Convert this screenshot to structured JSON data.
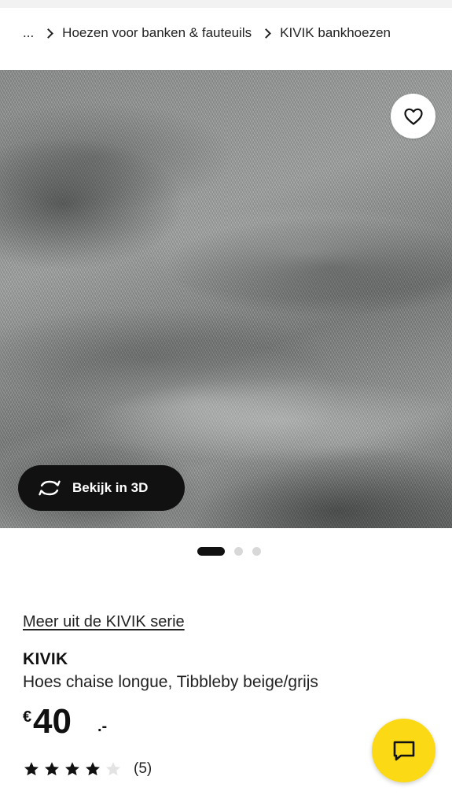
{
  "breadcrumb": {
    "ellipsis": "...",
    "items": [
      "Hoezen voor banken & fauteuils",
      "KIVIK bankhoezen"
    ]
  },
  "hero": {
    "favorite_icon": "heart-outline-icon",
    "view_3d_icon": "rotate-3d-icon",
    "view_3d_label": "Bekijk in 3D"
  },
  "carousel": {
    "total": 3,
    "active": 1
  },
  "product": {
    "series_link": "Meer uit de KIVIK serie",
    "name": "KIVIK",
    "description": "Hoes chaise longue, Tibbleby beige/grijs",
    "price_currency": "€",
    "price_integer": "40",
    "price_decimal": ".-",
    "rating_value": 4,
    "rating_max": 5,
    "review_count": "(5)"
  },
  "chat": {
    "icon": "chat-bubble-icon"
  },
  "colors": {
    "accent_yellow": "#fbd914",
    "dark": "#111111"
  }
}
